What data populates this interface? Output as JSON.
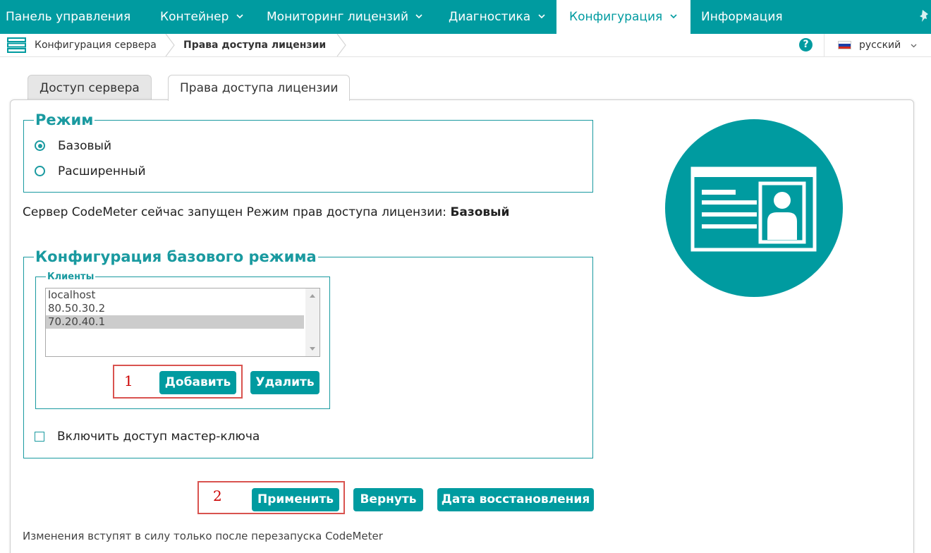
{
  "nav": {
    "items": [
      {
        "label": "Панель управления"
      },
      {
        "label": "Контейнер"
      },
      {
        "label": "Мониторинг лицензий"
      },
      {
        "label": "Диагностика"
      },
      {
        "label": "Конфигурация"
      },
      {
        "label": "Информация"
      }
    ],
    "active_index": 4
  },
  "breadcrumb": {
    "items": [
      "Конфигурация сервера",
      "Права доступа лицензии"
    ]
  },
  "language": {
    "label": "русский"
  },
  "help": {
    "label": "?"
  },
  "tabs": [
    {
      "label": "Доступ сервера",
      "active": false
    },
    {
      "label": "Права доступа лицензии",
      "active": true
    }
  ],
  "mode": {
    "legend": "Режим",
    "options": [
      {
        "label": "Базовый",
        "checked": true
      },
      {
        "label": "Расширенный",
        "checked": false
      }
    ]
  },
  "status": {
    "text": "Сервер CodeMeter сейчас запущен Режим прав доступа лицензии:",
    "value": "Базовый"
  },
  "basic_config": {
    "legend": "Конфигурация базового режима",
    "clients_legend": "Клиенты",
    "clients": [
      "localhost",
      "80.50.30.2",
      "70.20.40.1"
    ],
    "selected_index": 2,
    "add_label": "Добавить",
    "remove_label": "Удалить",
    "master_key_label": "Включить доступ мастер-ключа",
    "master_key_checked": false
  },
  "actions": {
    "apply_label": "Применить",
    "revert_label": "Вернуть",
    "restore_label": "Дата восстановления"
  },
  "note": "Изменения вступят в силу только после перезапуска CodeMeter",
  "annotations": {
    "marker1": "1",
    "marker2": "2"
  },
  "colors": {
    "accent": "#009ba0",
    "annotation": "#d9534f"
  },
  "icons": [
    "server-icon",
    "chevron-down-icon",
    "help-icon",
    "russian-flag-icon",
    "pin-icon",
    "license-card-icon"
  ]
}
